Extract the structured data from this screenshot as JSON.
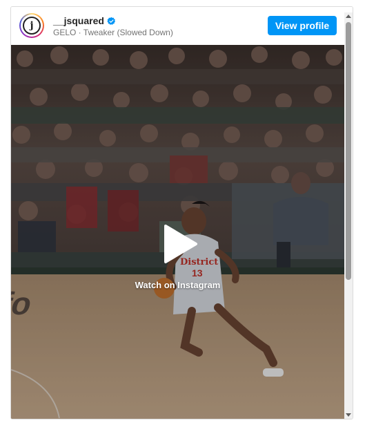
{
  "header": {
    "username": "__jsquared",
    "verified_icon": "verified-badge-icon",
    "avatar_letter": "j",
    "subtitle": "GELO · Tweaker (Slowed Down)",
    "view_profile_label": "View profile"
  },
  "media": {
    "play_icon": "play-icon",
    "watch_label": "Watch on Instagram",
    "jersey_text": "District",
    "jersey_number": "13",
    "court_text": "ser-fo"
  },
  "colors": {
    "accent": "#0095f6",
    "jersey": "#d8dbe2",
    "court": "#b89d7f"
  }
}
